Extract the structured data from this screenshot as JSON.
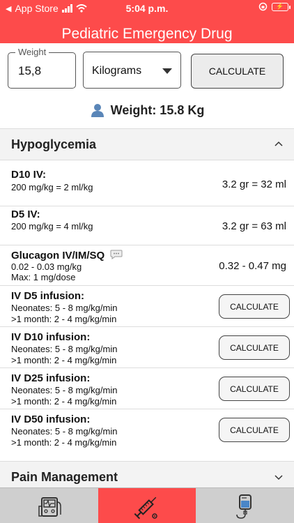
{
  "status": {
    "carrier": "App Store",
    "time": "5:04 p.m."
  },
  "header": {
    "title": "Pediatric Emergency Drug"
  },
  "weight": {
    "label": "Weight",
    "value": "15,8"
  },
  "unit": {
    "selected": "Kilograms"
  },
  "calculate_label": "CALCULATE",
  "weight_summary": "Weight: 15.8 Kg",
  "sections": [
    {
      "title": "Hypoglycemia",
      "expanded": true
    },
    {
      "title": "Pain Management",
      "expanded": false
    }
  ],
  "rows": [
    {
      "title": "D10 IV:",
      "sub1": "200 mg/kg = 2 ml/kg",
      "result": "3.2 gr = 32 ml"
    },
    {
      "title": "D5 IV:",
      "sub1": "200 mg/kg = 4 ml/kg",
      "result": "3.2 gr = 63 ml"
    },
    {
      "title": "Glucagon IV/IM/SQ",
      "sub1": "0.02 - 0.03 mg/kg",
      "sub2": "Max: 1 mg/dose",
      "result": "0.32 - 0.47 mg"
    },
    {
      "title": "IV D5 infusion:",
      "sub1": "Neonates: 5 - 8 mg/kg/min",
      "sub2": ">1 month:  2 - 4 mg/kg/min",
      "button": "CALCULATE"
    },
    {
      "title": "IV D10 infusion:",
      "sub1": "Neonates: 5 - 8 mg/kg/min",
      "sub2": ">1 month:  2 - 4 mg/kg/min",
      "button": "CALCULATE"
    },
    {
      "title": "IV D25 infusion:",
      "sub1": "Neonates: 5 - 8 mg/kg/min",
      "sub2": ">1 month:  2 - 4 mg/kg/min",
      "button": "CALCULATE"
    },
    {
      "title": "IV D50 infusion:",
      "sub1": "Neonates: 5 - 8 mg/kg/min",
      "sub2": ">1 month:  2 - 4 mg/kg/min",
      "button": "CALCULATE"
    }
  ],
  "tabs": [
    {
      "icon": "monitor-icon",
      "active": false
    },
    {
      "icon": "syringe-icon",
      "active": true
    },
    {
      "icon": "iv-bag-icon",
      "active": false
    }
  ],
  "colors": {
    "accent": "#fd4b4b",
    "tabbar": "#cfcfcf",
    "section_bg": "#f3f3f3"
  }
}
